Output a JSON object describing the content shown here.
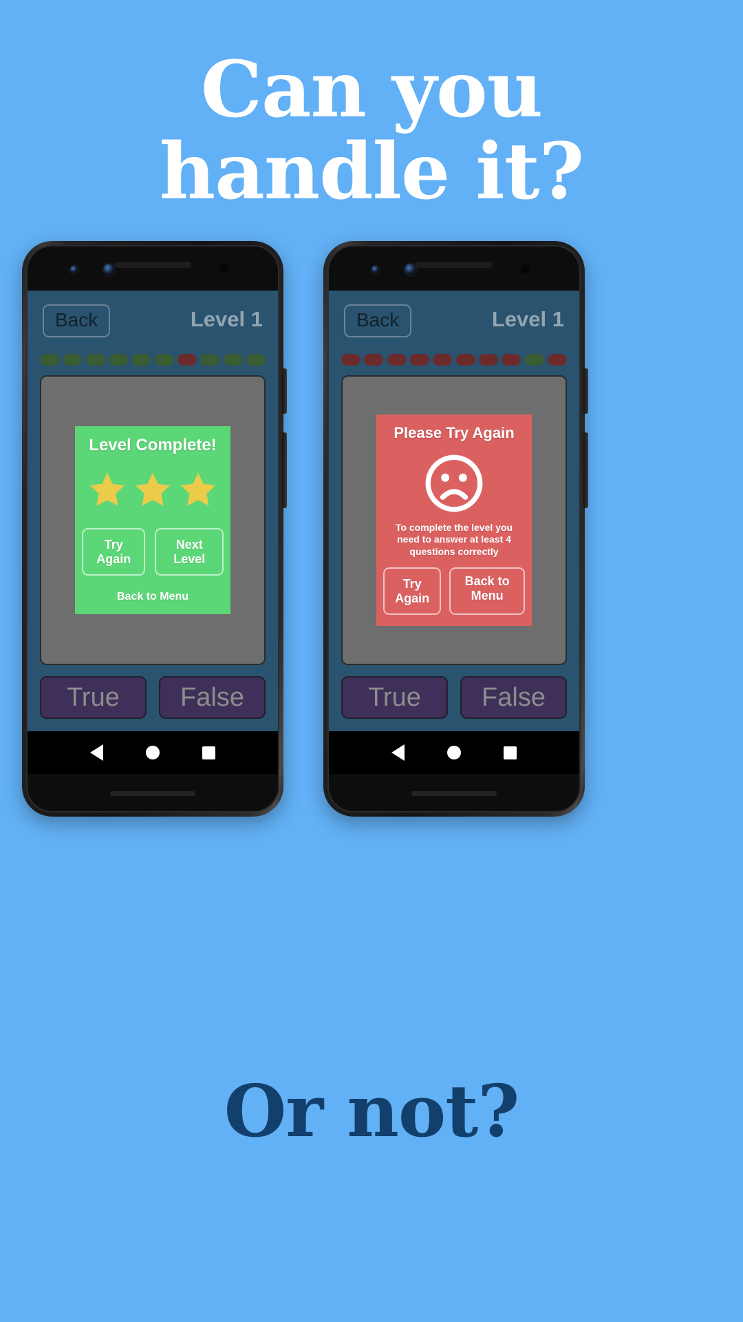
{
  "promo": {
    "headline_line1": "Can you",
    "headline_line2": "handle it?",
    "footer_text": "Or not?",
    "background_color": "#62b0f5",
    "headline_color": "#ffffff",
    "footer_color": "#123f6b"
  },
  "phones": [
    {
      "id": "phone-left",
      "screen": {
        "back_label": "Back",
        "level_label": "Level 1",
        "progress_pills": [
          "green",
          "green",
          "green",
          "green",
          "green",
          "green",
          "red",
          "green",
          "green",
          "green"
        ],
        "dialog": {
          "variant": "success",
          "background_color": "#5cd777",
          "title": "Level Complete!",
          "stars": 3,
          "star_color": "#eccb4a",
          "buttons": [
            "Try Again",
            "Next Level"
          ],
          "link": "Back to Menu"
        },
        "answer_buttons": [
          "True",
          "False"
        ]
      }
    },
    {
      "id": "phone-right",
      "screen": {
        "back_label": "Back",
        "level_label": "Level 1",
        "progress_pills": [
          "red",
          "red",
          "red",
          "red",
          "red",
          "red",
          "red",
          "red",
          "green",
          "red"
        ],
        "dialog": {
          "variant": "failure",
          "background_color": "#db6161",
          "title": "Please Try Again",
          "icon": "sad-face-icon",
          "message": "To complete the level you need to answer at least 4 questions correctly",
          "buttons": [
            "Try Again",
            "Back to Menu"
          ]
        },
        "answer_buttons": [
          "True",
          "False"
        ]
      }
    }
  ],
  "android_nav": {
    "back": "nav-back-icon",
    "home": "nav-home-icon",
    "recents": "nav-recents-icon"
  },
  "colors": {
    "pill_green": "#3a5c32",
    "pill_red": "#6b2b2b",
    "screen_bg": "#2a536f",
    "question_card": "#6e6e6e",
    "answer_button": "#3e3059"
  }
}
